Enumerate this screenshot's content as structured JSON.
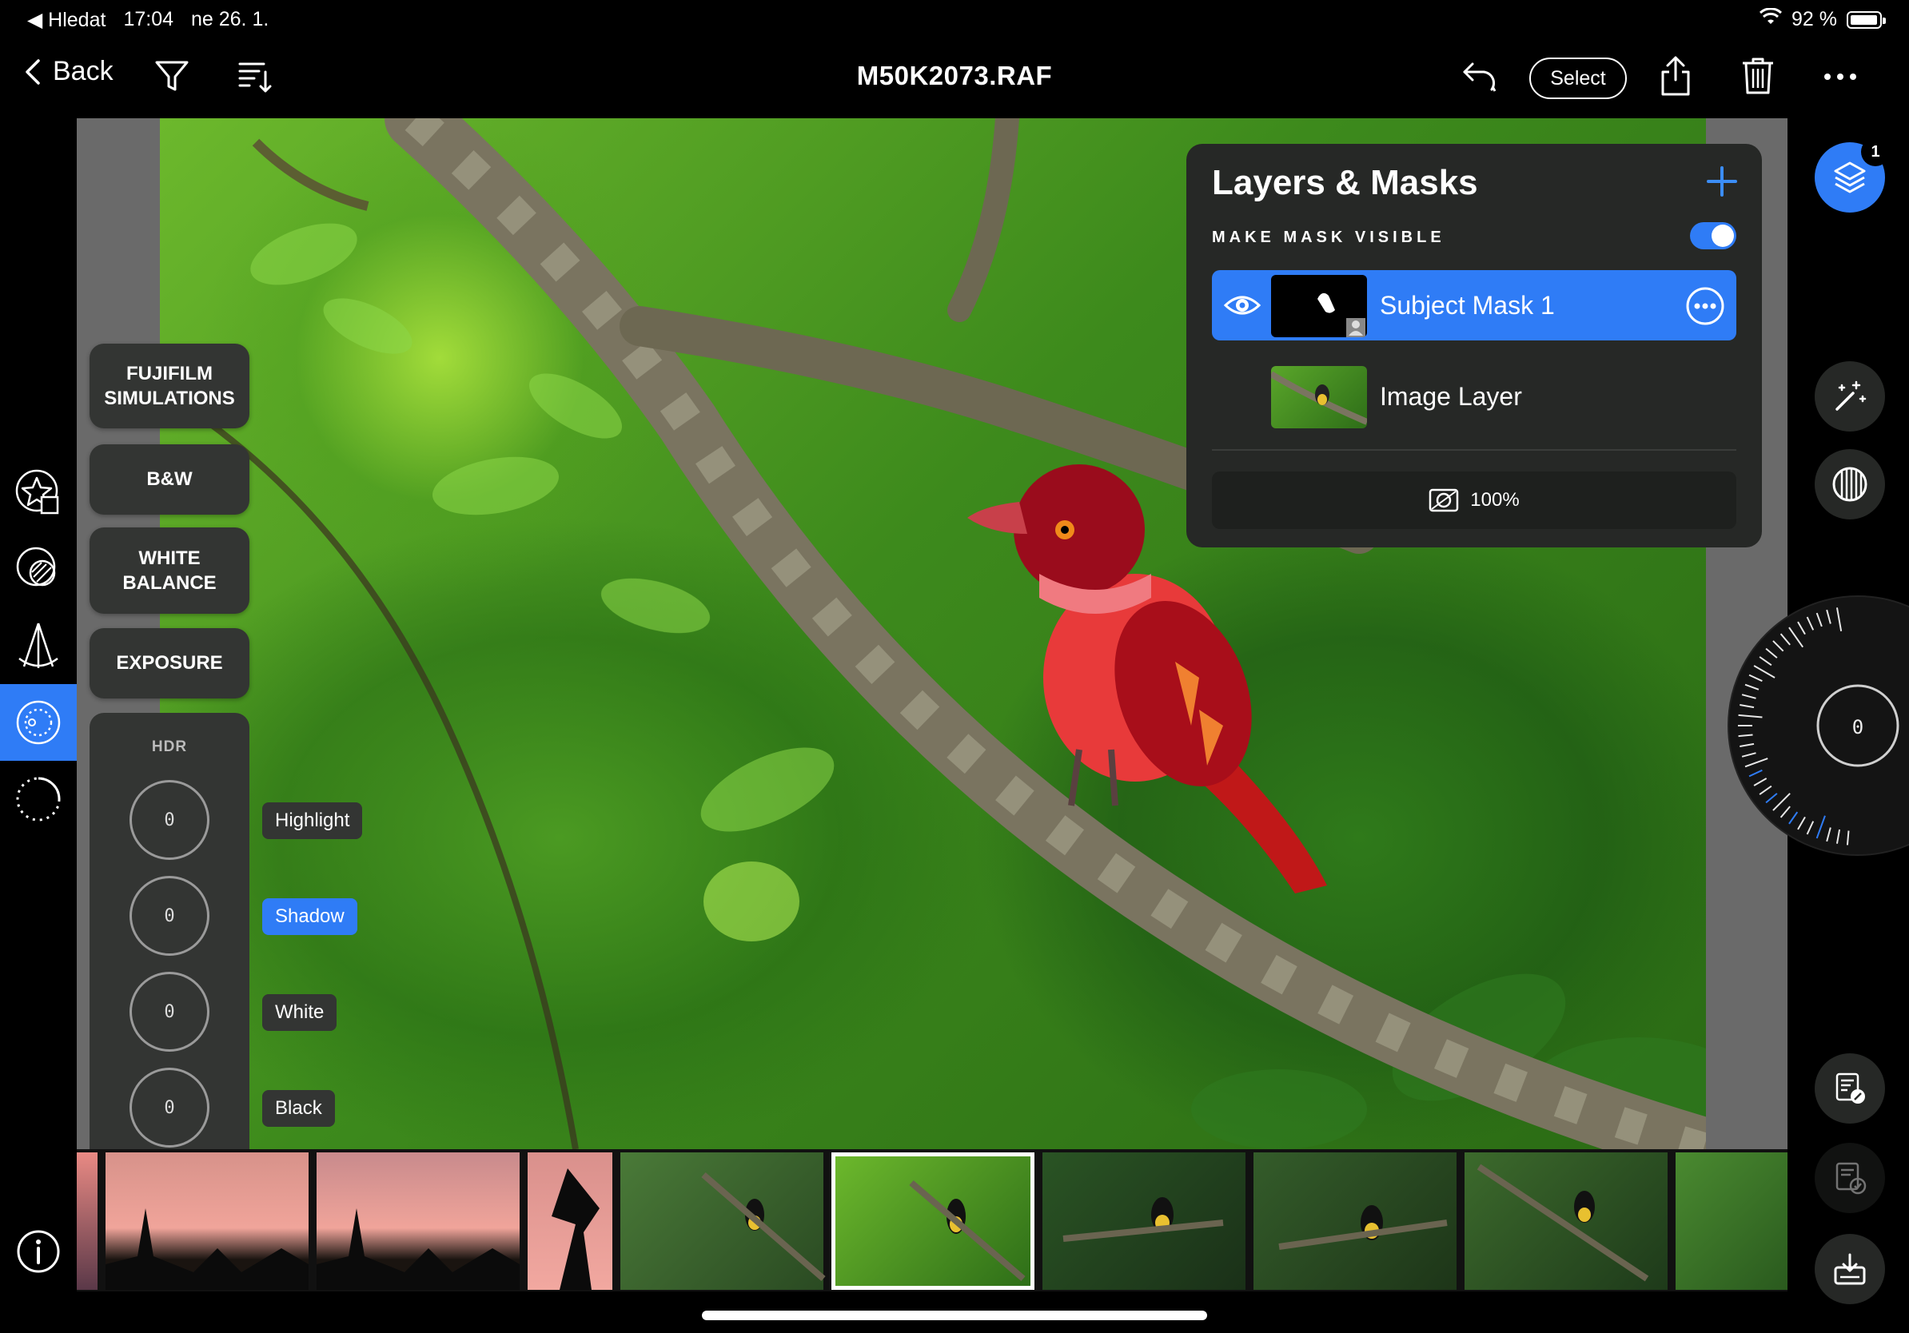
{
  "status_bar": {
    "back_app": "◀ Hledat",
    "time": "17:04",
    "date": "ne 26. 1.",
    "battery": "92 %"
  },
  "nav": {
    "back_label": "Back",
    "title": "M50K2073.RAF",
    "select_label": "Select"
  },
  "presets": [
    {
      "label": "FUJIFILM SIMULATIONS"
    },
    {
      "label": "B&W"
    },
    {
      "label": "WHITE BALANCE"
    },
    {
      "label": "EXPOSURE"
    }
  ],
  "hdr": {
    "title": "HDR",
    "dials": [
      {
        "label": "Highlight",
        "value": "0",
        "active": false
      },
      {
        "label": "Shadow",
        "value": "0",
        "active": true
      },
      {
        "label": "White",
        "value": "0",
        "active": false
      },
      {
        "label": "Black",
        "value": "0",
        "active": false
      }
    ]
  },
  "layers_panel": {
    "title": "Layers & Masks",
    "make_mask_visible_label": "MAKE MASK VISIBLE",
    "make_mask_visible": true,
    "layers": [
      {
        "name": "Subject Mask 1",
        "selected": true
      },
      {
        "name": "Image Layer",
        "selected": false
      }
    ],
    "opacity": "100%"
  },
  "right_panel": {
    "layer_badge": "1",
    "wheel_value": "0"
  },
  "colors": {
    "accent": "#2f7cf6",
    "panel": "#262826",
    "button": "#333533"
  }
}
